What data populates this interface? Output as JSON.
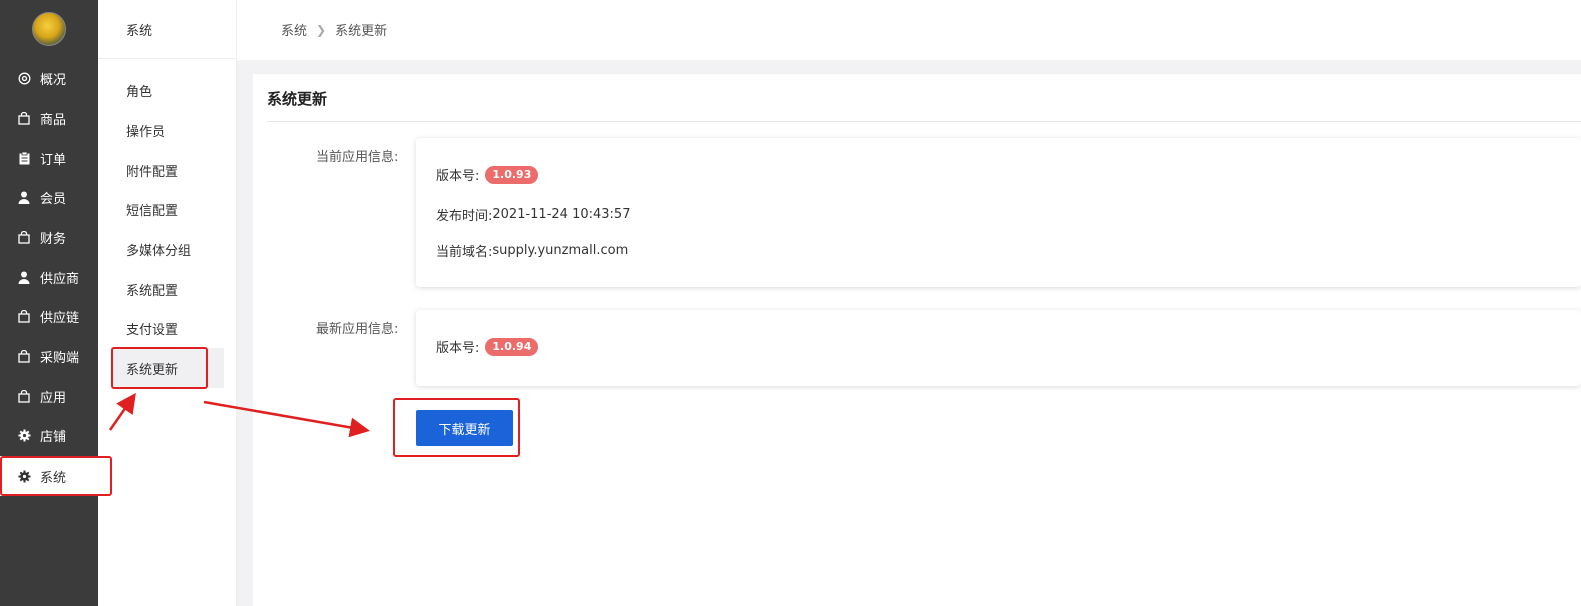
{
  "sidebar": {
    "items": [
      {
        "label": "概况",
        "icon": "dashboard-icon"
      },
      {
        "label": "商品",
        "icon": "bag-icon"
      },
      {
        "label": "订单",
        "icon": "clipboard-icon"
      },
      {
        "label": "会员",
        "icon": "user-icon"
      },
      {
        "label": "财务",
        "icon": "bag-icon"
      },
      {
        "label": "供应商",
        "icon": "user-icon"
      },
      {
        "label": "供应链",
        "icon": "bag-icon"
      },
      {
        "label": "采购端",
        "icon": "bag-icon"
      },
      {
        "label": "应用",
        "icon": "bag-icon"
      },
      {
        "label": "店铺",
        "icon": "gear-icon"
      },
      {
        "label": "系统",
        "icon": "gear-icon",
        "active": true
      }
    ]
  },
  "submenu": {
    "title": "系统",
    "items": [
      {
        "label": "角色"
      },
      {
        "label": "操作员"
      },
      {
        "label": "附件配置"
      },
      {
        "label": "短信配置"
      },
      {
        "label": "多媒体分组"
      },
      {
        "label": "系统配置"
      },
      {
        "label": "支付设置"
      },
      {
        "label": "系统更新",
        "active": true
      }
    ]
  },
  "breadcrumb": {
    "root": "系统",
    "current": "系统更新"
  },
  "page": {
    "title": "系统更新",
    "current_info": {
      "label": "当前应用信息:",
      "version_label": "版本号:",
      "version": "1.0.93",
      "release_time_label": "发布时间:",
      "release_time": "2021-11-24 10:43:57",
      "domain_label": "当前域名:",
      "domain": "supply.yunzmall.com"
    },
    "latest_info": {
      "label": "最新应用信息:",
      "version_label": "版本号:",
      "version": "1.0.94"
    },
    "download_button": "下载更新"
  },
  "colors": {
    "sidebar_bg": "#3b3b3b",
    "primary_button": "#1b63d8",
    "badge": "#ec6b6b",
    "annotation": "#e02020"
  }
}
